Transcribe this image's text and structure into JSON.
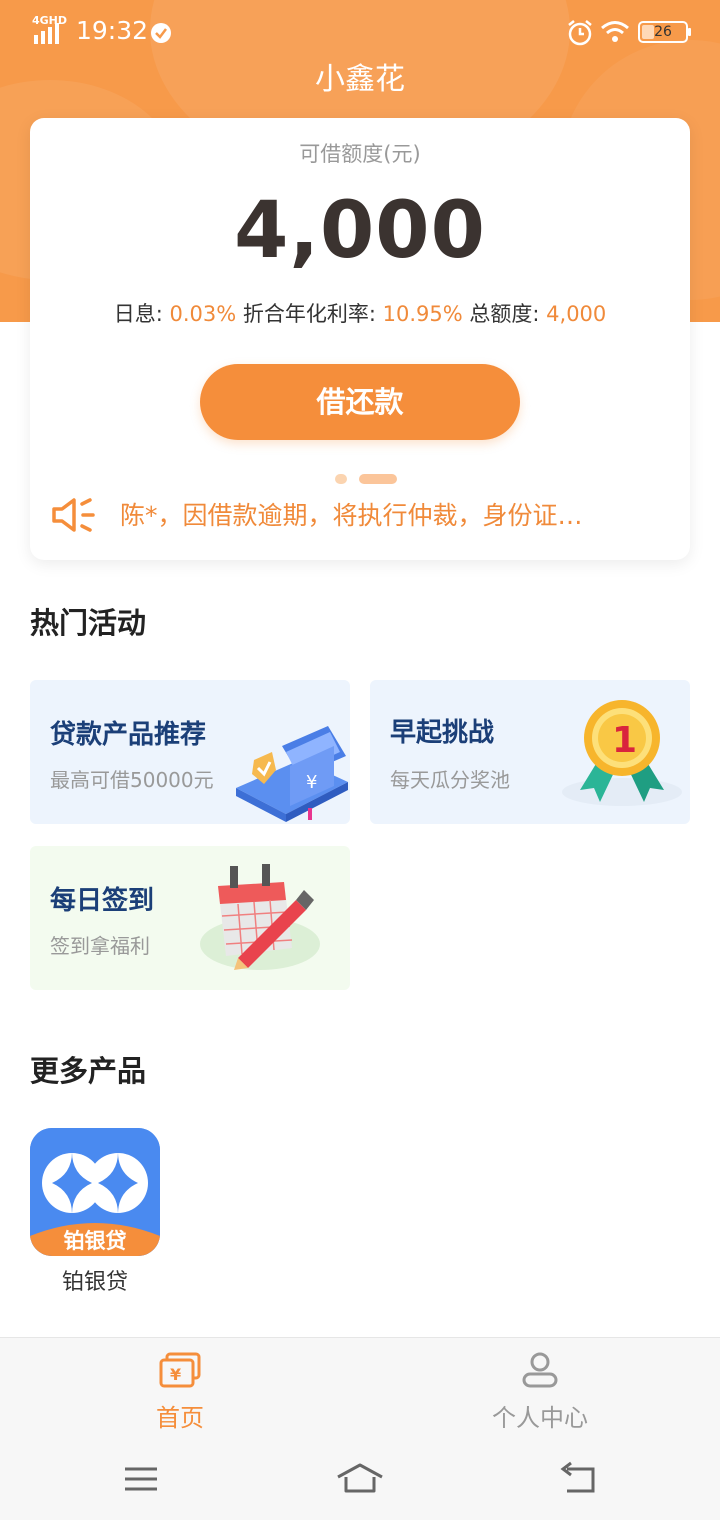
{
  "status_bar": {
    "network": "4GHD",
    "time": "19:32",
    "battery": "26",
    "icons": [
      "signal-icon",
      "verified-check-icon",
      "alarm-icon",
      "wifi-icon",
      "battery-icon"
    ]
  },
  "app": {
    "title": "小鑫花"
  },
  "credit": {
    "label": "可借额度(元)",
    "amount": "4,000",
    "daily_rate_label": "日息: ",
    "daily_rate": "0.03%",
    "annual_rate_label": " 折合年化利率: ",
    "annual_rate": "10.95%",
    "total_label": " 总额度: ",
    "total": "4,000",
    "button_label": "借还款",
    "notice": "陈*，因借款逾期，将执行仲裁，身份证…",
    "carousel_active_fraction": 0.5
  },
  "hot_activities": {
    "title": "热门活动",
    "items": [
      {
        "title": "贷款产品推荐",
        "subtitle": "最高可借50000元",
        "icon": "bank-building-icon"
      },
      {
        "title": "早起挑战",
        "subtitle": "每天瓜分奖池",
        "icon": "gold-medal-icon"
      },
      {
        "title": "每日签到",
        "subtitle": "签到拿福利",
        "icon": "calendar-pen-icon"
      }
    ]
  },
  "more_products": {
    "title": "更多产品",
    "items": [
      {
        "name": "铂银贷",
        "logo_text": "铂银贷"
      }
    ]
  },
  "tabbar": {
    "items": [
      {
        "label": "首页",
        "icon": "wallet-yuan-icon",
        "active": true
      },
      {
        "label": "个人中心",
        "icon": "user-icon",
        "active": false
      }
    ]
  },
  "colors": {
    "brand_orange": "#f58e3b",
    "header_orange": "#f79a4a",
    "highlight_text": "#f08a3a",
    "activity_title": "#1b3f78",
    "inactive_tab": "#999999"
  }
}
